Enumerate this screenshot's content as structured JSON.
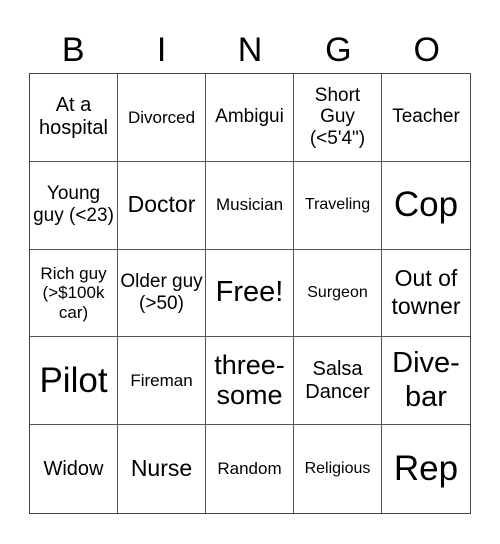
{
  "header": [
    "B",
    "I",
    "N",
    "G",
    "O"
  ],
  "cells": [
    "At a hospital",
    "Divorced",
    "Ambigui",
    "Short Guy (<5'4\")",
    "Teacher",
    "Young guy (<23)",
    "Doctor",
    "Musician",
    "Traveling",
    "Cop",
    "Rich guy (>$100k car)",
    "Older guy (>50)",
    "Free!",
    "Surgeon",
    "Out of towner",
    "Pilot",
    "Fireman",
    "three-some",
    "Salsa Dancer",
    "Dive-bar",
    "Widow",
    "Nurse",
    "Random",
    "Religious",
    "Rep"
  ]
}
